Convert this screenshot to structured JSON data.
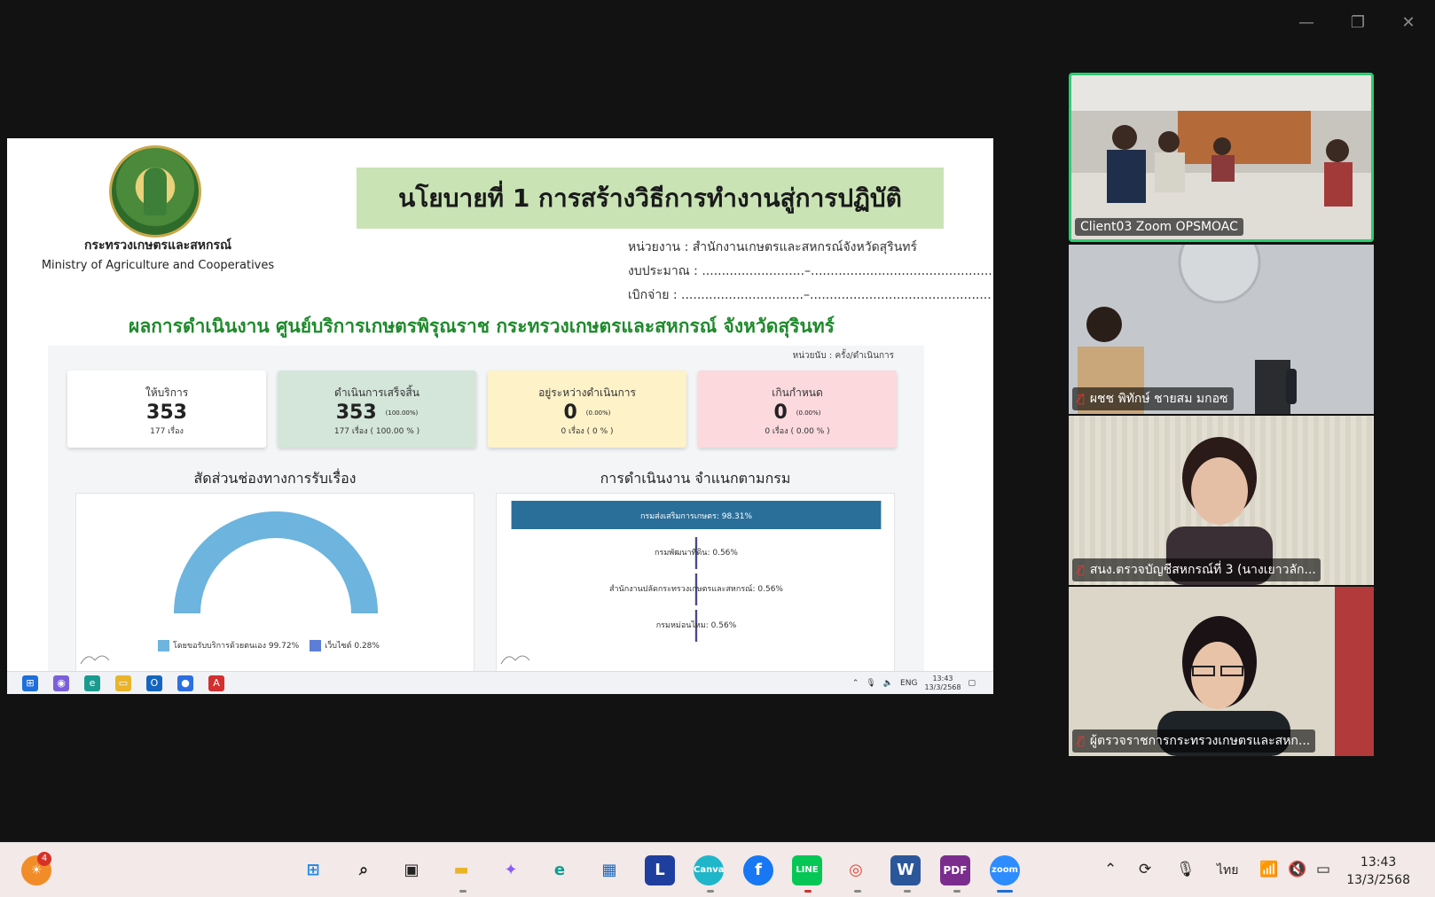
{
  "slide": {
    "ministry_th": "กระทรวงเกษตรและสหกรณ์",
    "ministry_en": "Ministry of Agriculture and Cooperatives",
    "title": "นโยบายที่ 1 การสร้างวิธีการทำงานสู่การปฏิบัติ",
    "agency": "หน่วยงาน : สำนักงานเกษตรและสหกรณ์จังหวัดสุรินทร์",
    "budget": "งบประมาณ : ..........................–..............................................",
    "disbursement": "เบิกจ่าย : ...............................–..............................................",
    "subtitle": "ผลการดำเนินงาน ศูนย์บริการเกษตรพิรุณราช กระทรวงเกษตรและสหกรณ์ จังหวัดสุรินทร์"
  },
  "dashboard": {
    "unit_label": "หน่วยนับ : ครั้ง/ดำเนินการ",
    "cards": [
      {
        "label": "ให้บริการ",
        "value": "353",
        "pct": "",
        "sub": "177 เรื่อง",
        "color": "#ffffff"
      },
      {
        "label": "ดำเนินการเสร็จสิ้น",
        "value": "353",
        "pct": "(100.00%)",
        "sub": "177 เรื่อง ( 100.00 % )",
        "color": "#d3e6d9"
      },
      {
        "label": "อยู่ระหว่างดำเนินการ",
        "value": "0",
        "pct": "(0.00%)",
        "sub": "0 เรื่อง ( 0 % )",
        "color": "#fdf2c8"
      },
      {
        "label": "เกินกำหนด",
        "value": "0",
        "pct": "(0.00%)",
        "sub": "0 เรื่อง ( 0.00 % )",
        "color": "#fbd9dd"
      }
    ],
    "left_title": "สัดส่วนช่องทางการรับเรื่อง",
    "right_title": "การดำเนินงาน จำแนกตามกรม",
    "legend": [
      {
        "label": "โดยขอรับบริการด้วยตนเอง 99.72%",
        "color": "#6db4de"
      },
      {
        "label": "เว็บไซต์ 0.28%",
        "color": "#5b7fd6"
      }
    ],
    "funnel": [
      {
        "label": "กรมส่งเสริมการเกษตร: 98.31%",
        "value": 98.31
      },
      {
        "label": "กรมพัฒนาที่ดิน: 0.56%",
        "value": 0.56
      },
      {
        "label": "สำนักงานปลัดกระทรวงเกษตรและสหกรณ์: 0.56%",
        "value": 0.56
      },
      {
        "label": "กรมหม่อนไหม: 0.56%",
        "value": 0.56
      }
    ]
  },
  "inner_taskbar": {
    "lang": "ENG",
    "time": "13:43",
    "date": "13/3/2568"
  },
  "participants": [
    {
      "name": "Client03 Zoom OPSMOAC",
      "muted": false
    },
    {
      "name": "ผชช พิทักษ์ ชายสม มกอซ",
      "muted": true
    },
    {
      "name": "สนง.ตรวจบัญชีสหกรณ์ที่ 3 (นางเยาวลัก...",
      "muted": true
    },
    {
      "name": "ผู้ตรวจราชการกระทรวงเกษตรและสหก...",
      "muted": true
    }
  ],
  "taskbar": {
    "notification_badge": "4",
    "lang": "ไทย",
    "time": "13:43",
    "date": "13/3/2568",
    "apps": [
      "start-icon",
      "search-icon",
      "task-view-icon",
      "file-explorer-icon",
      "copilot-icon",
      "edge-icon",
      "store-icon",
      "l-app-icon",
      "canva-icon",
      "facebook-icon",
      "line-icon",
      "chrome-icon",
      "word-icon",
      "pdf-icon",
      "zoom-icon"
    ]
  }
}
